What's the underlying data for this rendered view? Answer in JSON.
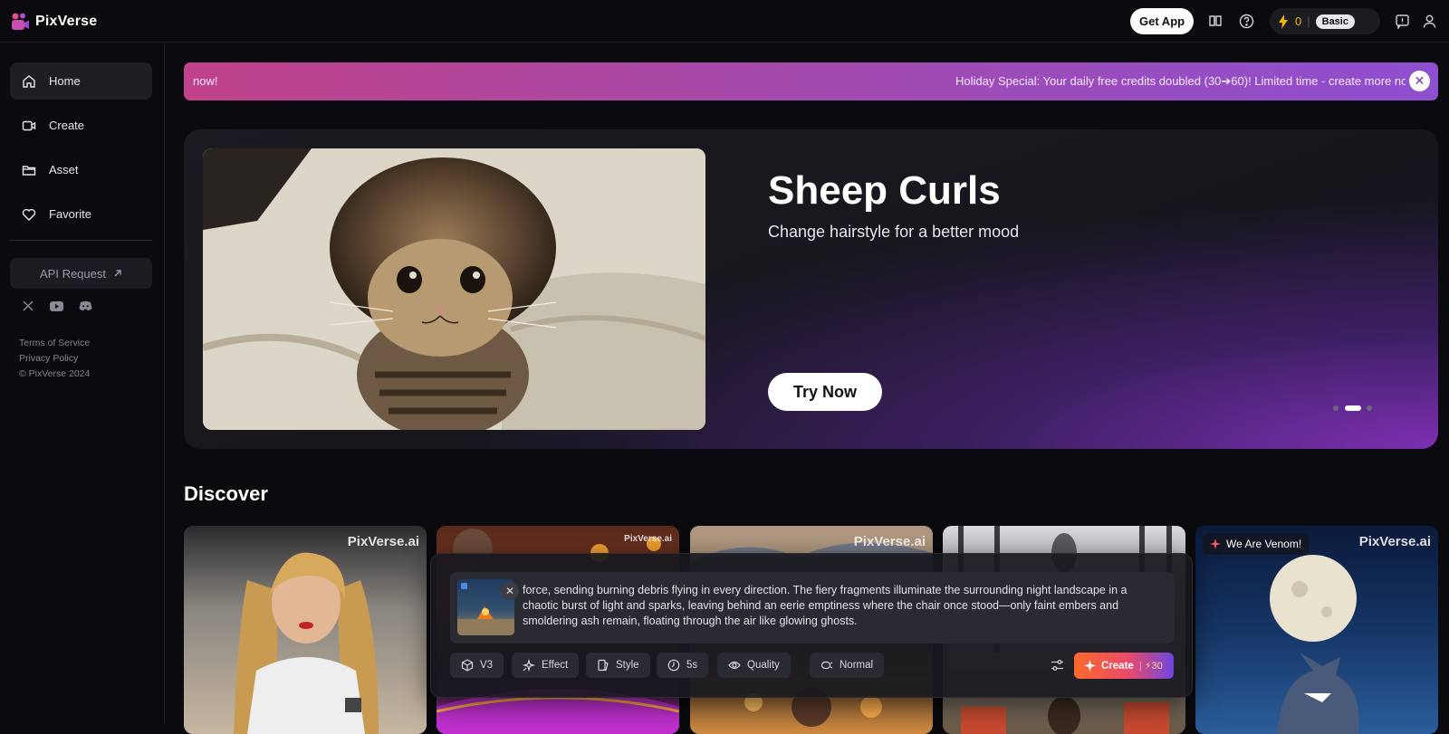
{
  "header": {
    "logo_text": "PixVerse",
    "get_app_label": "Get App",
    "credits": "0",
    "plan": "Basic",
    "icons": [
      "book-icon",
      "help-icon",
      "bolt-icon",
      "notification-icon",
      "user-icon"
    ]
  },
  "sidebar": {
    "items": [
      {
        "label": "Home",
        "icon": "home-icon"
      },
      {
        "label": "Create",
        "icon": "video-icon"
      },
      {
        "label": "Asset",
        "icon": "folder-icon"
      },
      {
        "label": "Favorite",
        "icon": "heart-icon"
      }
    ],
    "api_label": "API Request",
    "socials": [
      "x-icon",
      "youtube-icon",
      "discord-icon"
    ],
    "footer": {
      "terms": "Terms of Service",
      "privacy": "Privacy Policy",
      "copyright": "© PixVerse 2024"
    }
  },
  "banner": {
    "text_tail": "now!",
    "text": "Holiday Special: Your daily free credits doubled (30➔60)! Limited time - create more now!"
  },
  "hero": {
    "title": "Sheep Curls",
    "subtitle": "Change hairstyle for a better mood",
    "cta": "Try Now",
    "slides": 3,
    "active_slide": 2
  },
  "discover": {
    "title": "Discover",
    "cards": [
      {
        "watermark": "PixVerse.ai"
      },
      {
        "watermark": "PixVerse.ai"
      },
      {
        "watermark": "PixVerse.ai"
      },
      {
        "watermark": ""
      },
      {
        "watermark": "PixVerse.ai",
        "tag": "We Are Venom!"
      }
    ]
  },
  "composer": {
    "prompt": "force, sending burning debris flying in every direction. The fiery fragments illuminate the surrounding night landscape in a chaotic burst of light and sparks, leaving behind an eerie emptiness where the chair once stood—only faint embers and smoldering ash remain, floating through the air like glowing ghosts.",
    "chips": [
      {
        "label": "V3",
        "icon": "cube-icon"
      },
      {
        "label": "Effect",
        "icon": "sparkle-icon"
      },
      {
        "label": "Style",
        "icon": "style-icon"
      },
      {
        "label": "5s",
        "icon": "clock-icon"
      },
      {
        "label": "Quality",
        "icon": "eye-icon"
      },
      {
        "label": "Normal",
        "icon": "motion-icon"
      }
    ],
    "create_label": "Create",
    "create_cost": "30"
  },
  "colors": {
    "banner_start": "#c0428a",
    "banner_end": "#8e4fd0",
    "create_start": "#ff6a2b",
    "create_end": "#6d46e0",
    "credit_accent": "#f2b705"
  }
}
